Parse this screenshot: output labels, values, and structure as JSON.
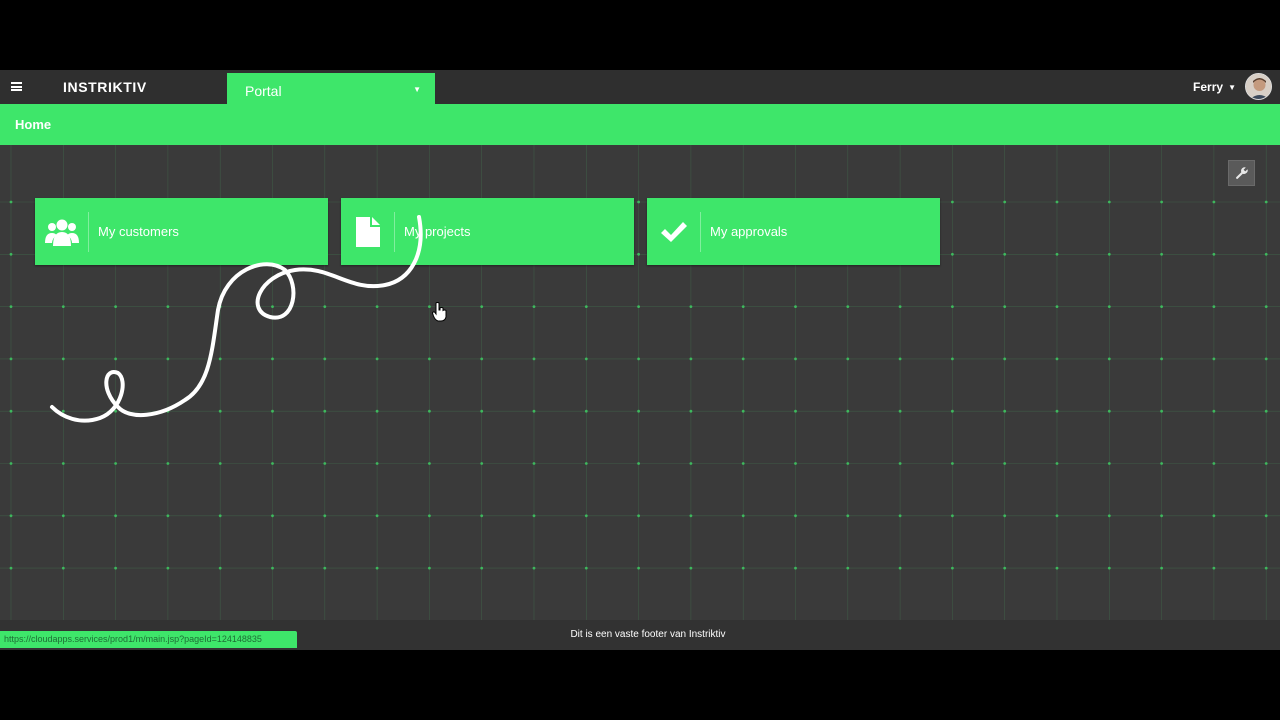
{
  "header": {
    "logo": "INSTRIKTIV",
    "app_selector": "Portal",
    "user_name": "Ferry"
  },
  "breadcrumb": {
    "home": "Home"
  },
  "tiles": [
    {
      "label": "My customers",
      "icon": "users-icon"
    },
    {
      "label": "My projects",
      "icon": "document-icon"
    },
    {
      "label": "My approvals",
      "icon": "checkmark-icon"
    }
  ],
  "toolbar": {
    "settings_icon": "wrench-icon"
  },
  "footer": {
    "text": "Dit is een vaste footer van Instriktiv",
    "status_url": "https://cloudapps.services/prod1/m/main.jsp?pageId=124148835"
  },
  "colors": {
    "accent": "#3ee66a",
    "background": "#3a3a3a",
    "topbar": "#2f2f2f"
  }
}
